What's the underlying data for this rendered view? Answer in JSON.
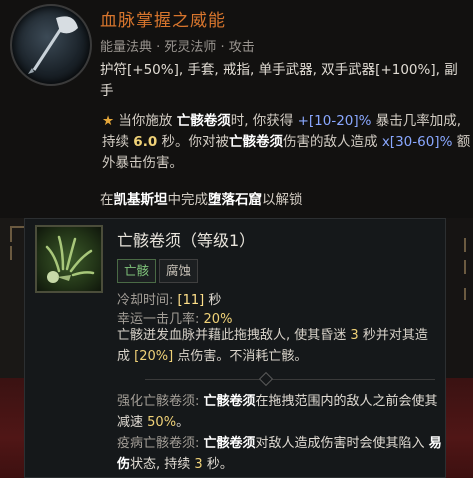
{
  "aspect": {
    "title": "血脉掌握之威能",
    "subtitle": "能量法典 · 死灵法师 · 攻击",
    "slots": "护符[+50%], 手套, 戒指, 单手武器, 双手武器[+100%], 副手",
    "star": "★",
    "desc_part1": "当你施放",
    "desc_skill1": "亡骸卷须",
    "desc_part2": "时, 你获得",
    "desc_range1": "+[10-20]%",
    "desc_part3": "暴击几率加成, 持续",
    "desc_dur": "6.0",
    "desc_part4": "秒。你对被",
    "desc_skill2": "亡骸卷须",
    "desc_part5": "伤害的敌人造成",
    "desc_range2": "x[30-60]%",
    "desc_part6": "额外暴击伤害。",
    "unlock_part1": "在",
    "unlock_region": "凯基斯坦",
    "unlock_part2": "中完成",
    "unlock_dungeon": "堕落石窟",
    "unlock_part3": "以解锁"
  },
  "skill": {
    "title": "亡骸卷须（等级1）",
    "tag_necro": "亡骸",
    "tag_blight": "腐蚀",
    "cooldown_label": "冷却时间:",
    "cooldown_value": "[11]",
    "cooldown_unit": "秒",
    "lucky_label": "幸运一击几率:",
    "lucky_value": "20%",
    "desc_part1": "亡骸迸发血脉并藉此拖拽敌人, 使其昏迷",
    "desc_stun": "3",
    "desc_part2": "秒并对其造成",
    "desc_dmg": "[20%]",
    "desc_part3": "点伤害。不消耗亡骸。",
    "mod1_label": "强化亡骸卷须:",
    "mod1_skill": "亡骸卷须",
    "mod1_part1": "在拖拽范围内的敌人之前会使其减速",
    "mod1_value": "50%",
    "mod1_end": "。",
    "mod2_label": "疫病亡骸卷须:",
    "mod2_skill": "亡骸卷须",
    "mod2_part1": "对敌人造成伤害时会使其陷入",
    "mod2_status": "易伤",
    "mod2_part2": "状态, 持续",
    "mod2_value": "3",
    "mod2_end": "秒。"
  }
}
